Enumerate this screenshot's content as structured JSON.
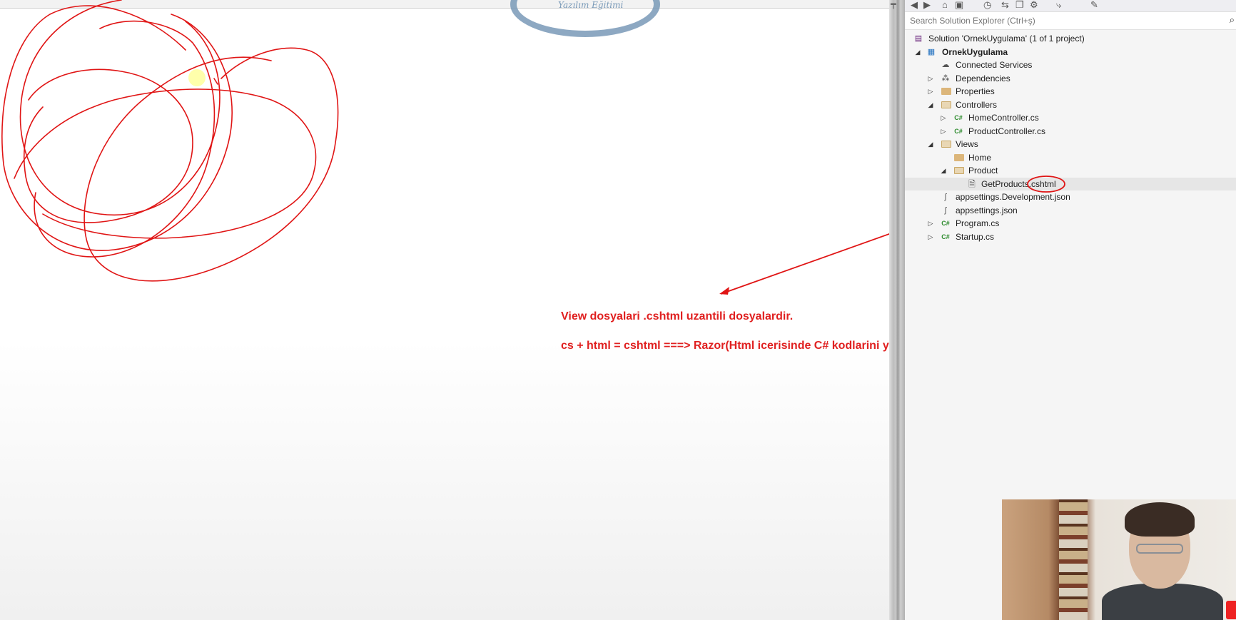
{
  "watermark": {
    "text": "Yazılım Eğitimi"
  },
  "annotations": {
    "line1": "View dosyalari .cshtml uzantili dosyalardir.",
    "line2": "cs + html = cshtml ===> Razor(Html icerisinde C# kodlarini yazmamizi saglayan bir teknolojidir)"
  },
  "solution_explorer": {
    "search_placeholder": "Search Solution Explorer (Ctrl+ş)",
    "tree": [
      {
        "label": "Solution 'OrnekUygulama' (1 of 1 project)",
        "icon": "solution-icon"
      },
      {
        "label": "OrnekUygulama",
        "icon": "project-icon",
        "expanded": true
      },
      {
        "label": "Connected Services",
        "icon": "connected-services-icon"
      },
      {
        "label": "Dependencies",
        "icon": "dependencies-icon",
        "expanded": false
      },
      {
        "label": "Properties",
        "icon": "properties-icon",
        "expanded": false
      },
      {
        "label": "Controllers",
        "icon": "folder-icon",
        "expanded": true
      },
      {
        "label": "HomeController.cs",
        "icon": "csharp-file-icon",
        "expanded": false
      },
      {
        "label": "ProductController.cs",
        "icon": "csharp-file-icon",
        "expanded": false
      },
      {
        "label": "Views",
        "icon": "folder-icon",
        "expanded": true
      },
      {
        "label": "Home",
        "icon": "folder-icon"
      },
      {
        "label": "Product",
        "icon": "folder-icon",
        "expanded": true
      },
      {
        "label": "GetProducts.cshtml",
        "icon": "cshtml-file-icon",
        "selected": true
      },
      {
        "label": "appsettings.Development.json",
        "icon": "json-file-icon"
      },
      {
        "label": "appsettings.json",
        "icon": "json-file-icon"
      },
      {
        "label": "Program.cs",
        "icon": "csharp-file-icon",
        "expanded": false
      },
      {
        "label": "Startup.cs",
        "icon": "csharp-file-icon",
        "expanded": false
      }
    ]
  },
  "colors": {
    "annotation": "#e02020",
    "folder": "#dcb67a",
    "csharp": "#2b8a2b"
  }
}
